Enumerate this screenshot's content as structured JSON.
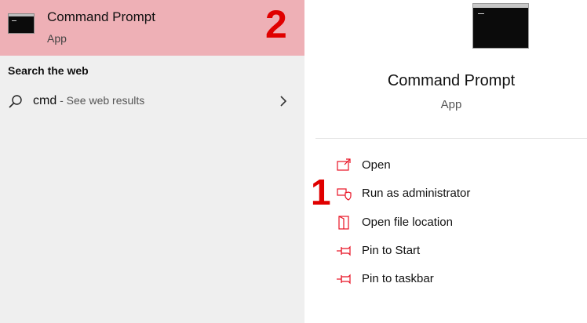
{
  "best_match": {
    "title": "Command Prompt",
    "subtitle": "App",
    "annotation": "2"
  },
  "web_section": {
    "heading": "Search the web",
    "query": "cmd",
    "suffix": " - See web results"
  },
  "detail": {
    "title": "Command Prompt",
    "subtitle": "App"
  },
  "actions": [
    {
      "label": "Open",
      "icon": "open-icon"
    },
    {
      "label": "Run as administrator",
      "icon": "shield-icon"
    },
    {
      "label": "Open file location",
      "icon": "folder-icon"
    },
    {
      "label": "Pin to Start",
      "icon": "pin-icon"
    },
    {
      "label": "Pin to taskbar",
      "icon": "pin-icon"
    }
  ],
  "annotations": {
    "step1": "1"
  },
  "colors": {
    "highlight": "#eeb0b6",
    "annotation": "#e00000",
    "icon_accent": "#e81123"
  }
}
